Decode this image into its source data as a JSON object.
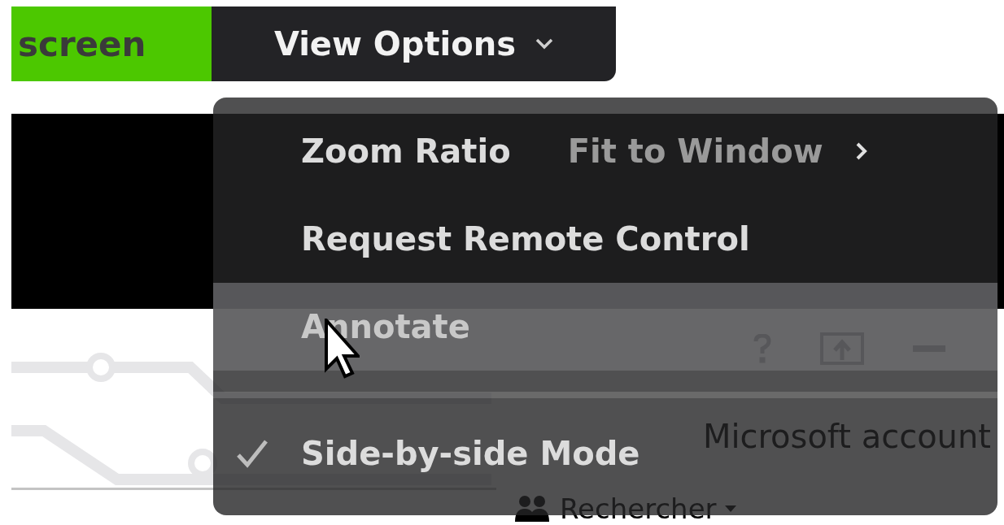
{
  "toolbar": {
    "share_label": "screen",
    "view_options": "View Options"
  },
  "menu": {
    "items": [
      {
        "kind": "submenu",
        "label": "Zoom Ratio",
        "value": "Fit to Window",
        "selected": false
      },
      {
        "kind": "action",
        "label": "Request Remote Control",
        "selected": false
      },
      {
        "kind": "action",
        "label": "Annotate",
        "selected": true
      },
      {
        "kind": "separator"
      },
      {
        "kind": "check",
        "label": "Side-by-side Mode",
        "checked": true,
        "selected": false
      }
    ]
  },
  "background": {
    "account_label": "Microsoft account",
    "search_button": "Rechercher"
  }
}
